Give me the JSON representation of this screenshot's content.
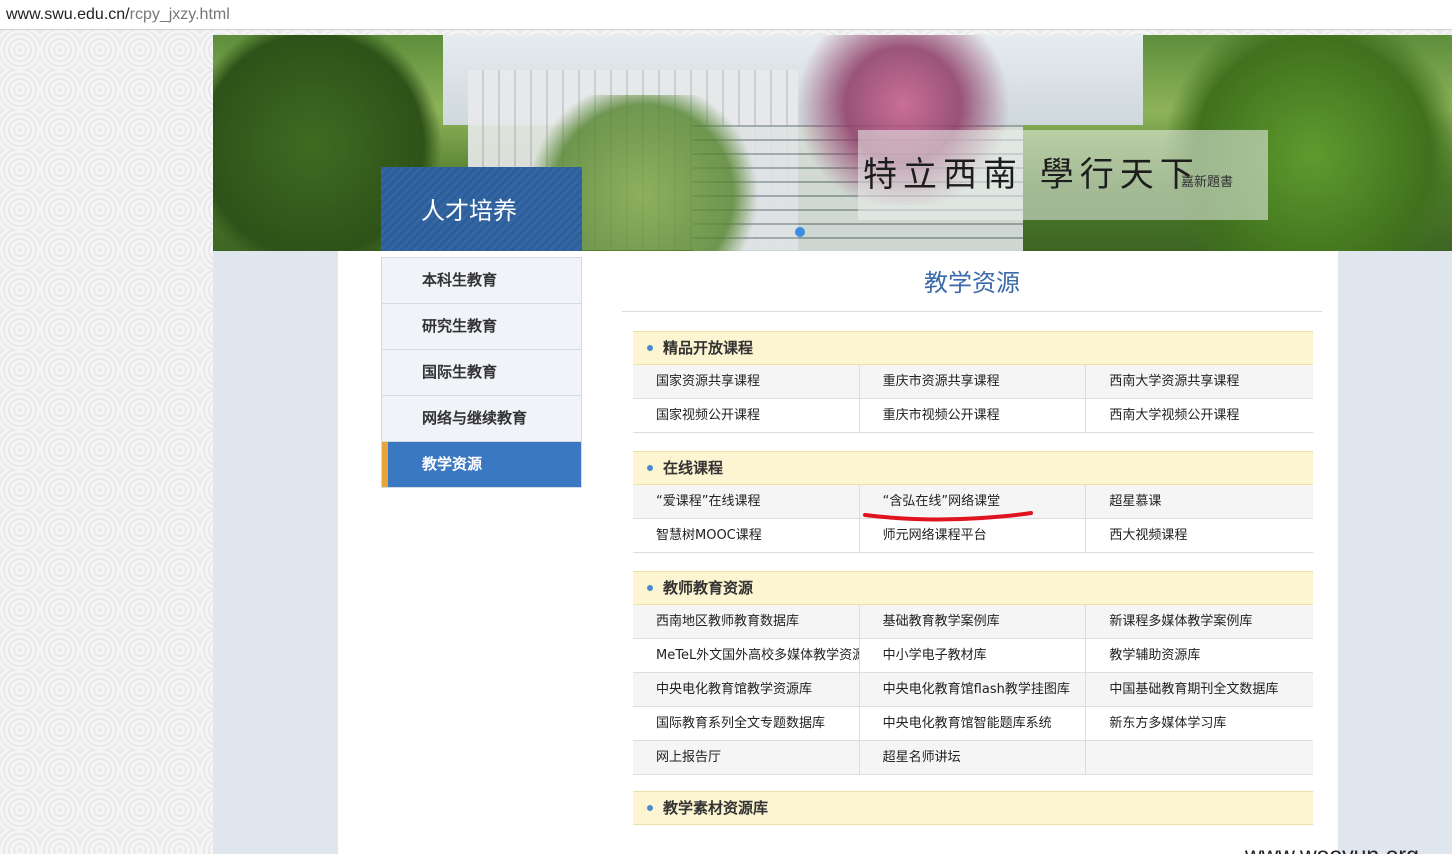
{
  "browser": {
    "url_domain": "www.swu.edu.cn/",
    "url_path": "rcpy_jxzy.html"
  },
  "banner": {
    "motto": "特立西南 學行天下",
    "signature": "嘉新題書"
  },
  "section": {
    "title": "人才培养"
  },
  "sidenav": {
    "items": [
      {
        "label": "本科生教育"
      },
      {
        "label": "研究生教育"
      },
      {
        "label": "国际生教育"
      },
      {
        "label": "网络与继续教育"
      },
      {
        "label": "教学资源"
      }
    ],
    "active_index": 4
  },
  "main": {
    "heading": "教学资源",
    "categories": [
      {
        "title": "精品开放课程",
        "rows": [
          [
            "国家资源共享课程",
            "重庆市资源共享课程",
            "西南大学资源共享课程"
          ],
          [
            "国家视频公开课程",
            "重庆市视频公开课程",
            "西南大学视频公开课程"
          ]
        ]
      },
      {
        "title": "在线课程",
        "rows": [
          [
            "“爱课程”在线课程",
            "“含弘在线”网络课堂",
            "超星慕课"
          ],
          [
            "智慧树MOOC课程",
            "师元网络课程平台",
            "西大视频课程"
          ]
        ]
      },
      {
        "title": "教师教育资源",
        "rows": [
          [
            "西南地区教师教育数据库",
            "基础教育教学案例库",
            "新课程多媒体教学案例库"
          ],
          [
            "MeTeL外文国外高校多媒体教学资源",
            "中小学电子教材库",
            "教学辅助资源库"
          ],
          [
            "中央电化教育馆教学资源库",
            "中央电化教育馆flash教学挂图库",
            "中国基础教育期刊全文数据库"
          ],
          [
            "国际教育系列全文专题数据库",
            "中央电化教育馆智能题库系统",
            "新东方多媒体学习库"
          ],
          [
            "网上报告厅",
            "超星名师讲坛",
            ""
          ]
        ]
      },
      {
        "title": "教学素材资源库",
        "rows": []
      }
    ]
  },
  "colors": {
    "accent_blue": "#3a78c3",
    "heading_blue": "#3b6aa8",
    "category_bg": "#fdf5d1",
    "annotation_red": "#e0141e"
  },
  "watermark": "www.wooyun.org"
}
